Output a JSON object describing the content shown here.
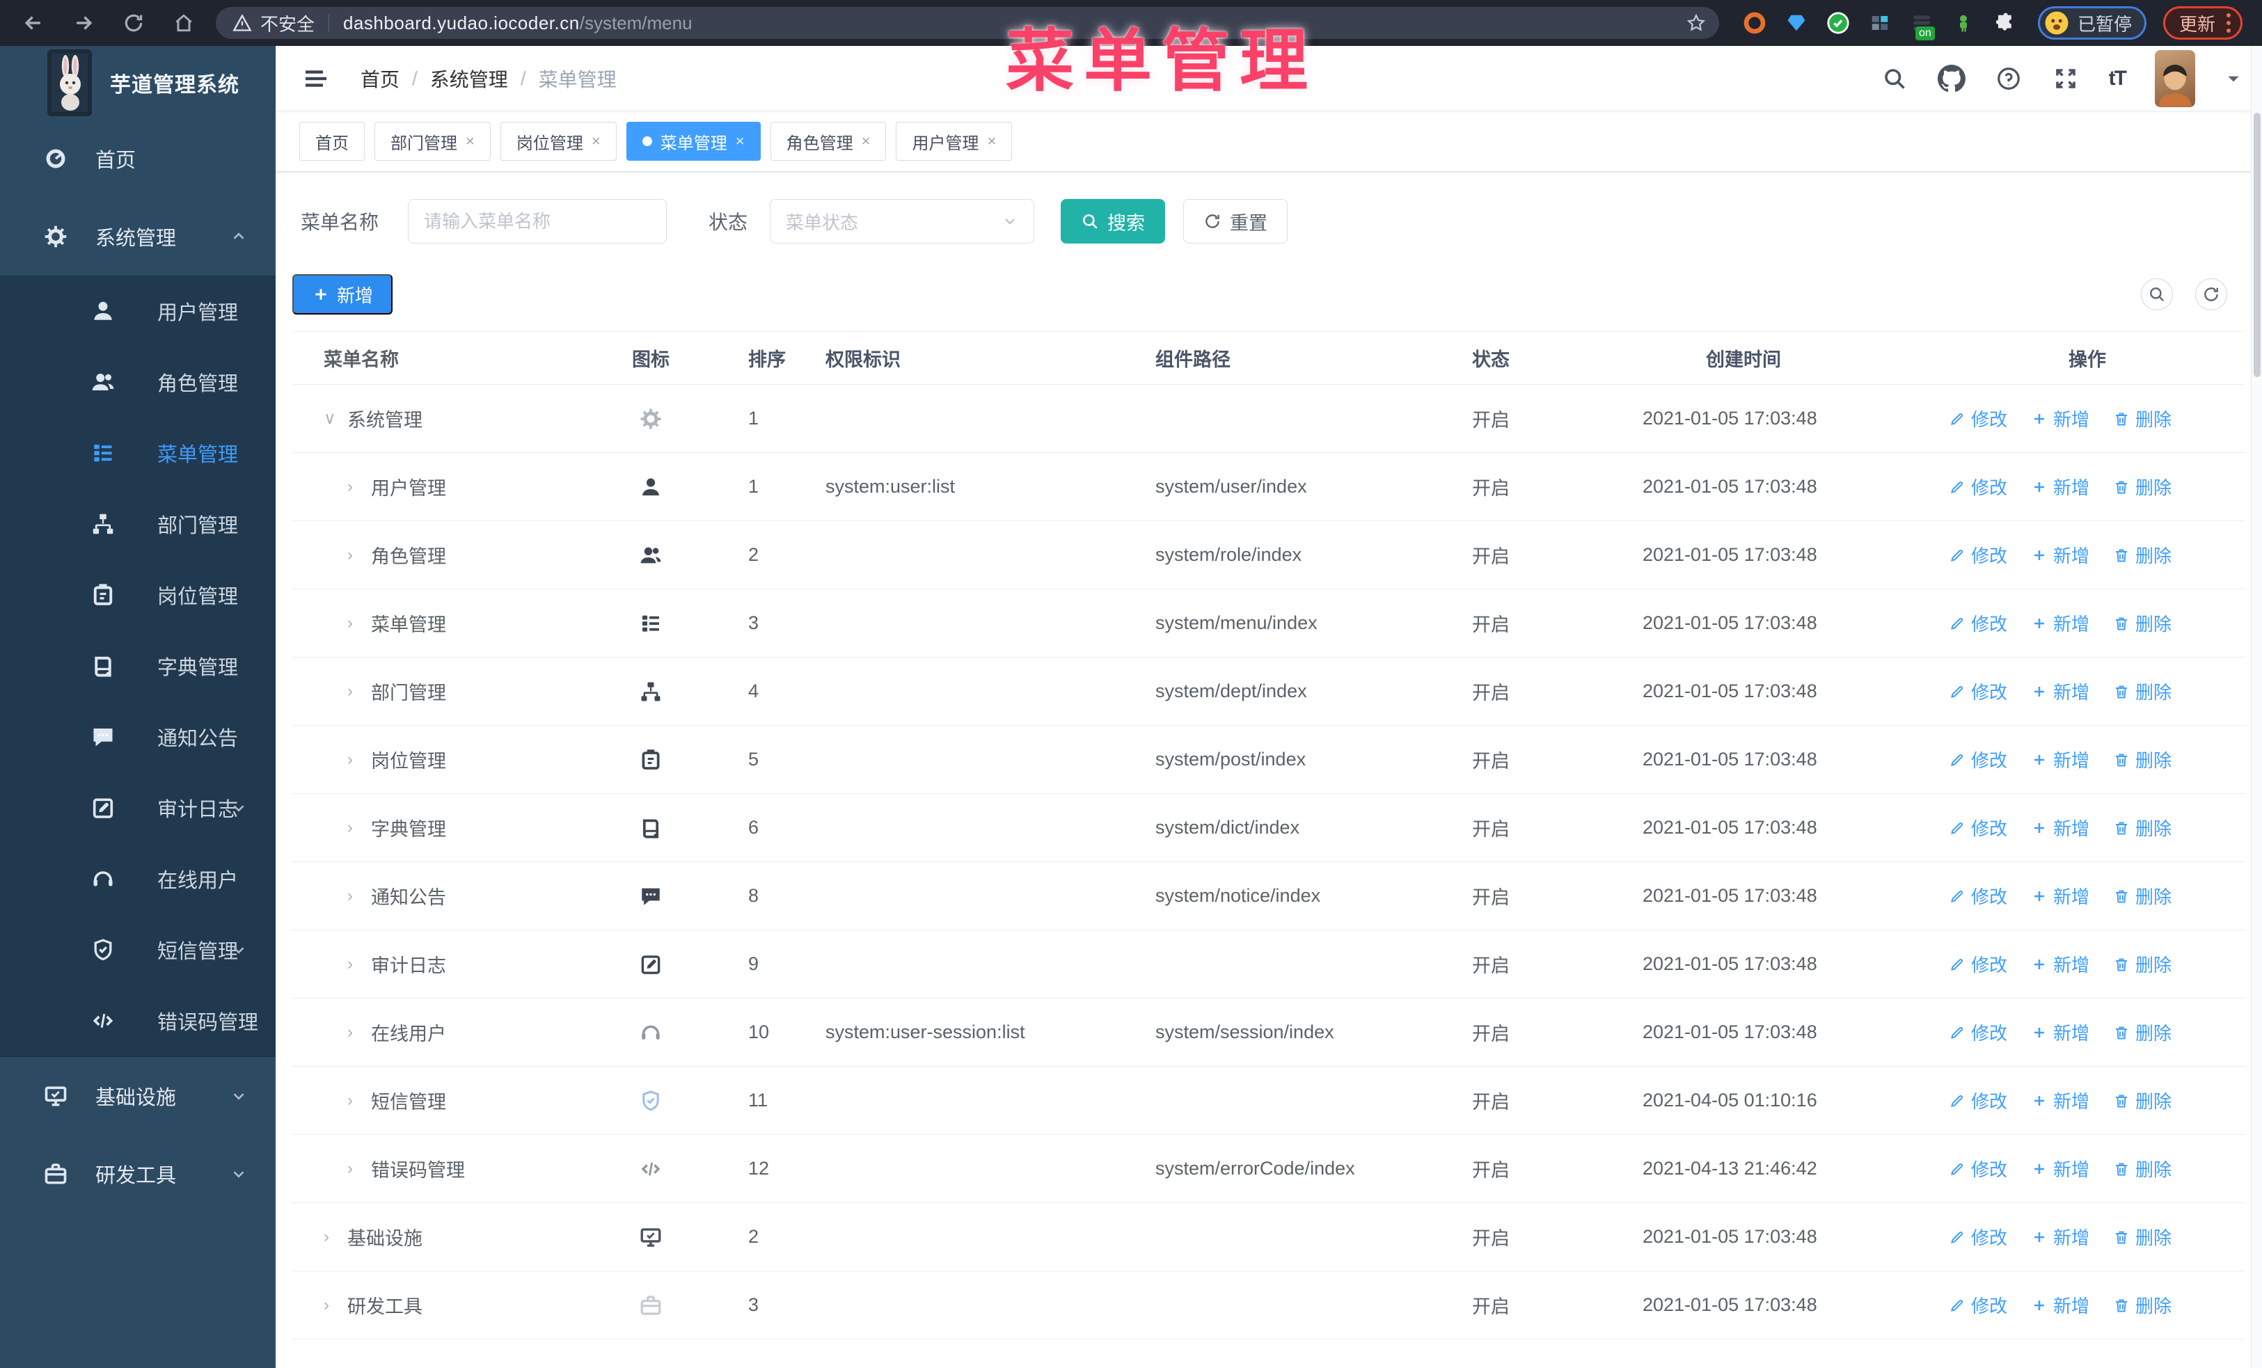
{
  "browser": {
    "security_label": "不安全",
    "url_host": "dashboard.yudao.iocoder.cn",
    "url_path": "/system/menu",
    "ext_badge": "on",
    "paused_label": "已暂停",
    "update_label": "更新"
  },
  "watermark": "菜单管理",
  "sidebar": {
    "logo_title": "芋道管理系统",
    "items": [
      {
        "label": "首页",
        "icon": "home",
        "level": 0,
        "chevron": "none",
        "active": false
      },
      {
        "label": "系统管理",
        "icon": "gear",
        "level": 0,
        "chevron": "up",
        "active": false
      },
      {
        "label": "用户管理",
        "icon": "user",
        "level": 1,
        "chevron": "none",
        "active": false
      },
      {
        "label": "角色管理",
        "icon": "users",
        "level": 1,
        "chevron": "none",
        "active": false
      },
      {
        "label": "菜单管理",
        "icon": "menu",
        "level": 1,
        "chevron": "none",
        "active": true
      },
      {
        "label": "部门管理",
        "icon": "tree",
        "level": 1,
        "chevron": "none",
        "active": false
      },
      {
        "label": "岗位管理",
        "icon": "post",
        "level": 1,
        "chevron": "none",
        "active": false
      },
      {
        "label": "字典管理",
        "icon": "dict",
        "level": 1,
        "chevron": "none",
        "active": false
      },
      {
        "label": "通知公告",
        "icon": "notice",
        "level": 1,
        "chevron": "none",
        "active": false
      },
      {
        "label": "审计日志",
        "icon": "edit",
        "level": 1,
        "chevron": "down",
        "active": false
      },
      {
        "label": "在线用户",
        "icon": "online",
        "level": 1,
        "chevron": "none",
        "active": false
      },
      {
        "label": "短信管理",
        "icon": "sms",
        "level": 1,
        "chevron": "down",
        "active": false
      },
      {
        "label": "错误码管理",
        "icon": "code",
        "level": 1,
        "chevron": "none",
        "active": false
      },
      {
        "label": "基础设施",
        "icon": "infra",
        "level": 0,
        "chevron": "down",
        "active": false
      },
      {
        "label": "研发工具",
        "icon": "tool",
        "level": 0,
        "chevron": "down",
        "active": false
      }
    ]
  },
  "header": {
    "breadcrumb": [
      "首页",
      "系统管理",
      "菜单管理"
    ]
  },
  "tabs": [
    {
      "label": "首页",
      "closable": false,
      "active": false
    },
    {
      "label": "部门管理",
      "closable": true,
      "active": false
    },
    {
      "label": "岗位管理",
      "closable": true,
      "active": false
    },
    {
      "label": "菜单管理",
      "closable": true,
      "active": true
    },
    {
      "label": "角色管理",
      "closable": true,
      "active": false
    },
    {
      "label": "用户管理",
      "closable": true,
      "active": false
    }
  ],
  "filters": {
    "name_label": "菜单名称",
    "name_placeholder": "请输入菜单名称",
    "status_label": "状态",
    "status_placeholder": "菜单状态",
    "search_label": "搜索",
    "reset_label": "重置"
  },
  "toolbar": {
    "add_label": "新增"
  },
  "table": {
    "columns": [
      "菜单名称",
      "图标",
      "排序",
      "权限标识",
      "组件路径",
      "状态",
      "创建时间",
      "操作"
    ],
    "actions": {
      "edit": "修改",
      "add": "新增",
      "delete": "删除"
    },
    "rows": [
      {
        "name": "系统管理",
        "level": 0,
        "arrow": "down",
        "icon": "gear",
        "icon_color": "#b0b6bd",
        "sort": 1,
        "perm": "",
        "path": "",
        "status": "开启",
        "created": "2021-01-05 17:03:48"
      },
      {
        "name": "用户管理",
        "level": 1,
        "arrow": "right",
        "icon": "user",
        "icon_color": "#3d4754",
        "sort": 1,
        "perm": "system:user:list",
        "path": "system/user/index",
        "status": "开启",
        "created": "2021-01-05 17:03:48"
      },
      {
        "name": "角色管理",
        "level": 1,
        "arrow": "right",
        "icon": "users",
        "icon_color": "#3d4754",
        "sort": 2,
        "perm": "",
        "path": "system/role/index",
        "status": "开启",
        "created": "2021-01-05 17:03:48"
      },
      {
        "name": "菜单管理",
        "level": 1,
        "arrow": "right",
        "icon": "menu",
        "icon_color": "#3d4754",
        "sort": 3,
        "perm": "",
        "path": "system/menu/index",
        "status": "开启",
        "created": "2021-01-05 17:03:48"
      },
      {
        "name": "部门管理",
        "level": 1,
        "arrow": "right",
        "icon": "tree",
        "icon_color": "#3d4754",
        "sort": 4,
        "perm": "",
        "path": "system/dept/index",
        "status": "开启",
        "created": "2021-01-05 17:03:48"
      },
      {
        "name": "岗位管理",
        "level": 1,
        "arrow": "right",
        "icon": "post",
        "icon_color": "#3d4754",
        "sort": 5,
        "perm": "",
        "path": "system/post/index",
        "status": "开启",
        "created": "2021-01-05 17:03:48"
      },
      {
        "name": "字典管理",
        "level": 1,
        "arrow": "right",
        "icon": "dict",
        "icon_color": "#3d4754",
        "sort": 6,
        "perm": "",
        "path": "system/dict/index",
        "status": "开启",
        "created": "2021-01-05 17:03:48"
      },
      {
        "name": "通知公告",
        "level": 1,
        "arrow": "right",
        "icon": "notice",
        "icon_color": "#3d4754",
        "sort": 8,
        "perm": "",
        "path": "system/notice/index",
        "status": "开启",
        "created": "2021-01-05 17:03:48"
      },
      {
        "name": "审计日志",
        "level": 1,
        "arrow": "right",
        "icon": "edit",
        "icon_color": "#3d4754",
        "sort": 9,
        "perm": "",
        "path": "",
        "status": "开启",
        "created": "2021-01-05 17:03:48"
      },
      {
        "name": "在线用户",
        "level": 1,
        "arrow": "right",
        "icon": "online",
        "icon_color": "#8f98a1",
        "sort": 10,
        "perm": "system:user-session:list",
        "path": "system/session/index",
        "status": "开启",
        "created": "2021-01-05 17:03:48"
      },
      {
        "name": "短信管理",
        "level": 1,
        "arrow": "right",
        "icon": "sms",
        "icon_color": "#9ec1ea",
        "sort": 11,
        "perm": "",
        "path": "",
        "status": "开启",
        "created": "2021-04-05 01:10:16"
      },
      {
        "name": "错误码管理",
        "level": 1,
        "arrow": "right",
        "icon": "code",
        "icon_color": "#8f98a1",
        "sort": 12,
        "perm": "",
        "path": "system/errorCode/index",
        "status": "开启",
        "created": "2021-04-13 21:46:42"
      },
      {
        "name": "基础设施",
        "level": 0,
        "arrow": "right",
        "icon": "infra",
        "icon_color": "#4a5562",
        "sort": 2,
        "perm": "",
        "path": "",
        "status": "开启",
        "created": "2021-01-05 17:03:48"
      },
      {
        "name": "研发工具",
        "level": 0,
        "arrow": "right",
        "icon": "tool",
        "icon_color": "#c8cdd3",
        "sort": 3,
        "perm": "",
        "path": "",
        "status": "开启",
        "created": "2021-01-05 17:03:48"
      }
    ]
  },
  "colors": {
    "primary": "#409eff",
    "teal": "#21b3a8",
    "sidebar": "#2d4a63",
    "submenu": "#21394f",
    "watermark": "#fa4168"
  }
}
